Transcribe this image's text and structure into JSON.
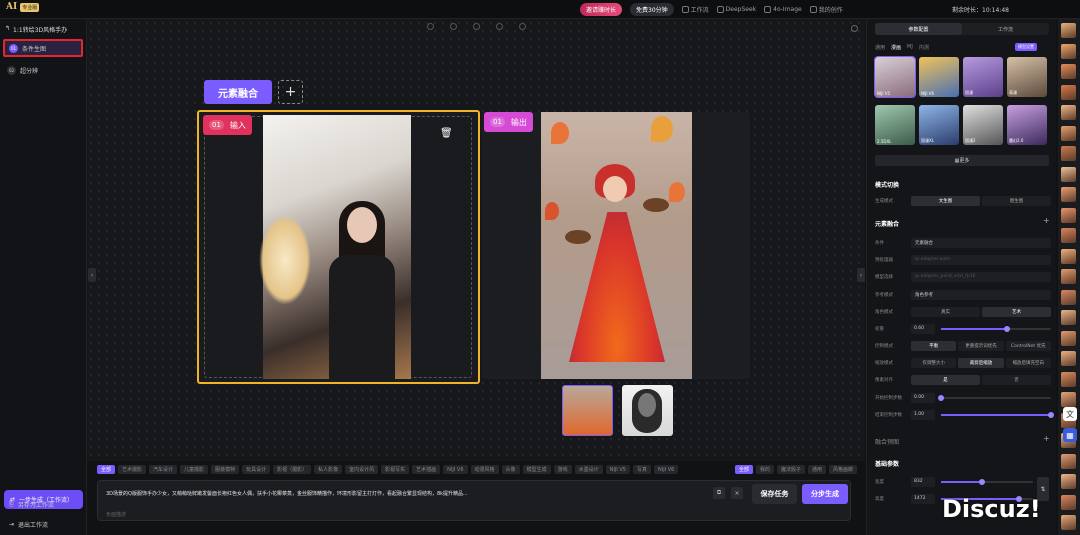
{
  "topbar": {
    "logo_mark": "AI",
    "badge": "专业版",
    "gift": "邀请赚时长",
    "free": "免费30分钟",
    "nav": [
      "工作流",
      "DeepSeek",
      "4o-Image",
      "我的创作"
    ],
    "clock": "剩余时长：10:14:48"
  },
  "left": {
    "title": "1:1转绘3D风格手办",
    "items": [
      {
        "num": "01",
        "label": "条件生图"
      },
      {
        "num": "02",
        "label": "超分辨"
      }
    ],
    "onestep": "一步生成（工作流）",
    "save_workflow": "另存为工作流",
    "exit_workflow": "退出工作流"
  },
  "canvas": {
    "node_title": "元素融合",
    "add": "+",
    "input_num": "01",
    "input_label": "输入",
    "output_num": "01",
    "output_label": "输出"
  },
  "tags": [
    "全部",
    "艺术摄影",
    "汽车设计",
    "儿童摄影",
    "服装模特",
    "玩具设计",
    "影视（摄影）",
    "私人影像",
    "室内设计风",
    "影视写实",
    "艺术插画",
    "NIJI V6",
    "动漫风格",
    "头像",
    "模型生成",
    "游戏",
    "水墨设计",
    "NIJI V5",
    "写真",
    "NIJI V6"
  ],
  "tag_right": {
    "all": "全部",
    "fav": "我的",
    "magic": "魔法骰子",
    "general": "通用",
    "style": "风格画廊"
  },
  "prompt": {
    "text": "3D场景的Q版服饰手办少女，又萌萌哒鲜嫩发髻面长袍红色女人偶，扶手小花椰菜蒸，金丝服饰精描作，环境形影留主打灯作，看起融合繁显现结构，8k提升精品...",
    "negative": "负面描述",
    "save": "保存任务",
    "gen": "分步生成"
  },
  "right": {
    "tabs": [
      "参数配置",
      "工作流"
    ],
    "subtabs": [
      "通用",
      "漫画",
      "MJ",
      "内测"
    ],
    "model_btn": "模型设置",
    "models": [
      {
        "label": "NIJI V5",
        "c1": "#d9d0d8",
        "c2": "#8a6b7a"
      },
      {
        "label": "NIJI V6",
        "c1": "#f0c35a",
        "c2": "#4a6fb3"
      },
      {
        "label": "国漫",
        "c1": "#b79be0",
        "c2": "#5b3f8a"
      },
      {
        "label": "萌漫",
        "c1": "#d6c0a8",
        "c2": "#5c4a3c"
      },
      {
        "label": "2.5DXL",
        "c1": "#9fc9b0",
        "c2": "#3c5a48"
      },
      {
        "label": "国漫XL",
        "c1": "#8fb5e8",
        "c2": "#2a3d6b"
      },
      {
        "label": "国漫2",
        "c1": "#e0e0e0",
        "c2": "#555555"
      },
      {
        "label": "魔幻2.0",
        "c1": "#c9a0e0",
        "c2": "#3b2a5c"
      }
    ],
    "more": "更多",
    "sec_mode": "模式切换",
    "mode_key": "生成模式",
    "mode_opts": [
      "文生图",
      "图生图"
    ],
    "sec_element": "元素融合",
    "rows": [
      {
        "k": "条件",
        "v": "元素融合"
      },
      {
        "k": "预处理器",
        "v": "ip-adapter-auto"
      },
      {
        "k": "模型选择",
        "v": "ip-adapter_pulid_sdxl_fp16"
      },
      {
        "k": "参考模式",
        "v": "角色参考"
      }
    ],
    "render_key": "角色模式",
    "render_opts": [
      "真实",
      "艺术"
    ],
    "weight_key": "权重",
    "weight": "0.60",
    "weight_frac": 0.6,
    "ctrl_key": "控制模式",
    "ctrl_opts": [
      "平衡",
      "更重提示词优先",
      "ControlNet 优先"
    ],
    "resize_key": "缩放模式",
    "resize_opts": [
      "仅调整大小",
      "裁剪后缩放",
      "缩放后填充空白"
    ],
    "pixel_key": "像素对齐",
    "pixel_opts": [
      "是",
      "否"
    ],
    "start_key": "开始控制步数",
    "start": "0.00",
    "start_frac": 0.0,
    "end_key": "结束控制步数",
    "end": "1.00",
    "end_frac": 1.0,
    "sec_blend": "融合预图",
    "sec_base": "基础参数",
    "width_key": "宽度",
    "width": "832",
    "width_frac": 0.45,
    "height_key": "高度",
    "height": "1472",
    "height_frac": 0.85
  },
  "watermark": "Discuz!",
  "strip_colors": [
    "#e9b27a",
    "#f0a86a",
    "#e58d5a",
    "#d77a4a",
    "#f2b88a",
    "#e6a06c",
    "#c97c50",
    "#f0c29a",
    "#eaa070",
    "#e8956b",
    "#d9845c",
    "#f1b07c",
    "#e59c6a",
    "#d88860",
    "#eab58a",
    "#e29b6d",
    "#f0b184",
    "#dd8c5f",
    "#e8a57a",
    "#d2835a",
    "#edb78d",
    "#e39e72",
    "#f3b58a",
    "#d9875d",
    "#eaa977"
  ]
}
